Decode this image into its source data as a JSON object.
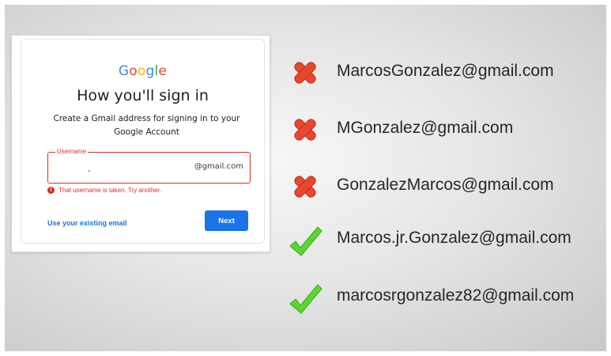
{
  "signin_card": {
    "logo": [
      "G",
      "o",
      "o",
      "g",
      "l",
      "e"
    ],
    "title": "How you'll sign in",
    "subtitle": "Create a Gmail address for signing in to your Google Account",
    "username_label": "Username",
    "username_value": "-",
    "domain_suffix": "@gmail.com",
    "error_text": "That username is taken. Try another.",
    "existing_email_link": "Use your existing email",
    "next_button": "Next"
  },
  "email_options": [
    {
      "email": "MarcosGonzalez@gmail.com",
      "status": "invalid",
      "icon": "red-x-icon"
    },
    {
      "email": "MGonzalez@gmail.com",
      "status": "invalid",
      "icon": "red-x-icon"
    },
    {
      "email": "GonzalezMarcos@gmail.com",
      "status": "invalid",
      "icon": "red-x-icon"
    },
    {
      "email": "Marcos.jr.Gonzalez@gmail.com",
      "status": "valid",
      "icon": "green-check-icon"
    },
    {
      "email": "marcosrgonzalez82@gmail.com",
      "status": "valid",
      "icon": "green-check-icon"
    }
  ],
  "colors": {
    "error_red": "#d93025",
    "google_blue": "#1a73e8",
    "x_mark": "#e8472e",
    "check_mark": "#5cd62e"
  }
}
